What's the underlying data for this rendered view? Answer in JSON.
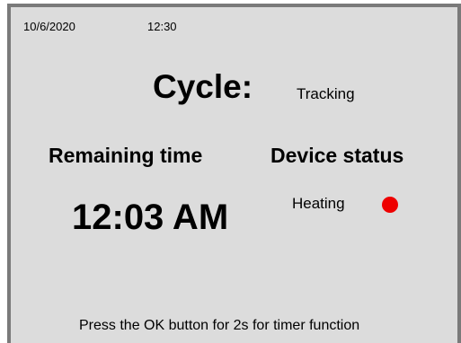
{
  "header": {
    "date": "10/6/2020",
    "time": "12:30"
  },
  "cycle": {
    "label": "Cycle:",
    "value": "Tracking"
  },
  "remaining": {
    "heading": "Remaining time",
    "value": "12:03 AM"
  },
  "device": {
    "heading": "Device status",
    "status": "Heating",
    "indicator_color": "#ee0000",
    "indicator_icon": "red-status-dot"
  },
  "footer": {
    "hint": "Press the OK button for 2s for timer function"
  },
  "colors": {
    "screen_background": "#dcdcdc",
    "frame": "#7a7a7a"
  }
}
